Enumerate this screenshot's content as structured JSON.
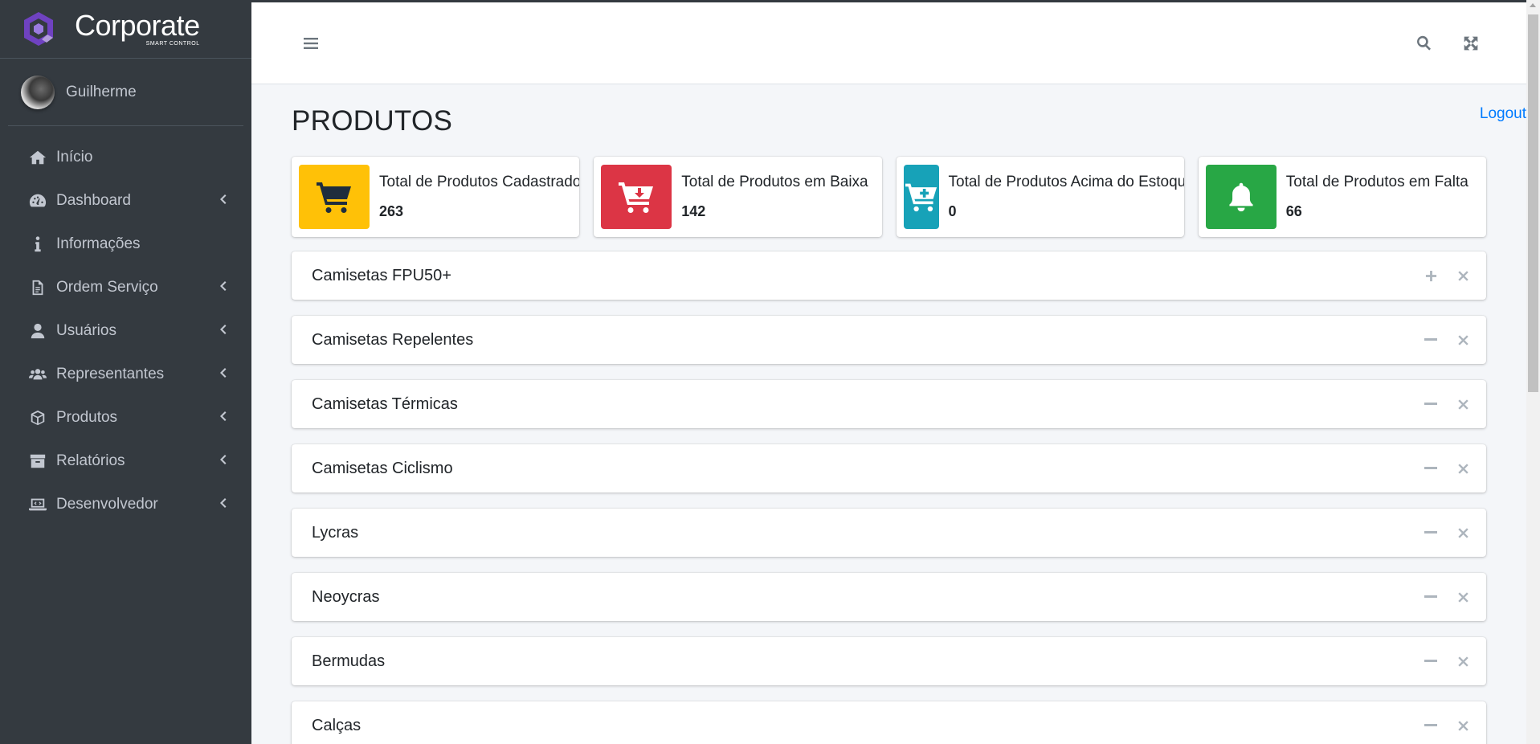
{
  "brand": {
    "name": "Corporate",
    "sub": "SMART CONTROL"
  },
  "user": {
    "name": "Guilherme"
  },
  "sidebar": {
    "items": [
      {
        "label": "Início",
        "icon": "home-icon",
        "chevron": false
      },
      {
        "label": "Dashboard",
        "icon": "tachometer-icon",
        "chevron": true
      },
      {
        "label": "Informações",
        "icon": "info-icon",
        "chevron": false
      },
      {
        "label": "Ordem Serviço",
        "icon": "file-icon",
        "chevron": true
      },
      {
        "label": "Usuários",
        "icon": "user-icon",
        "chevron": true
      },
      {
        "label": "Representantes",
        "icon": "users-icon",
        "chevron": true
      },
      {
        "label": "Produtos",
        "icon": "box-icon",
        "chevron": true
      },
      {
        "label": "Relatórios",
        "icon": "archive-icon",
        "chevron": true
      },
      {
        "label": "Desenvolvedor",
        "icon": "laptop-code-icon",
        "chevron": true
      }
    ]
  },
  "page": {
    "title": "PRODUTOS",
    "logout": "Logout"
  },
  "stats": [
    {
      "label": "Total de Produtos Cadastrados",
      "value": "263",
      "color": "#ffc107",
      "icon": "cart-icon"
    },
    {
      "label": "Total de Produtos em Baixa",
      "value": "142",
      "color": "#dc3545",
      "icon": "cart-arrow-down-icon"
    },
    {
      "label": "Total de Produtos Acima do Estoque",
      "value": "0",
      "color": "#17a2b8",
      "icon": "cart-plus-icon"
    },
    {
      "label": "Total de Produtos em Falta",
      "value": "66",
      "color": "#28a745",
      "icon": "bell-icon"
    }
  ],
  "cards": [
    {
      "title": "Camisetas FPU50+",
      "collapsed": true
    },
    {
      "title": "Camisetas Repelentes",
      "collapsed": false
    },
    {
      "title": "Camisetas Térmicas",
      "collapsed": false
    },
    {
      "title": "Camisetas Ciclismo",
      "collapsed": false
    },
    {
      "title": "Lycras",
      "collapsed": false
    },
    {
      "title": "Neoycras",
      "collapsed": false
    },
    {
      "title": "Bermudas",
      "collapsed": false
    },
    {
      "title": "Calças",
      "collapsed": false
    }
  ]
}
